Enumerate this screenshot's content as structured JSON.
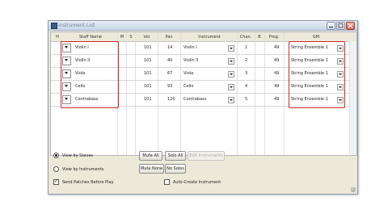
{
  "window": {
    "title": "Instrument List"
  },
  "columns": {
    "h": "H",
    "staff_name": "Staff Name",
    "m": "M",
    "s": "S",
    "vol": "Vol.",
    "pan": "Pan",
    "instrument": "Instrument",
    "chan": "Chan.",
    "b": "B",
    "prog": "Prog.",
    "gm": "GM"
  },
  "rows": [
    {
      "staff": "Violin I",
      "vol": "101",
      "pan": "14",
      "instrument": "Violin I",
      "chan": "1",
      "prog": "49",
      "gm": "String Ensemble 1"
    },
    {
      "staff": "Violin II",
      "vol": "101",
      "pan": "40",
      "instrument": "Violin II",
      "chan": "2",
      "prog": "49",
      "gm": "String Ensemble 1"
    },
    {
      "staff": "Viola",
      "vol": "101",
      "pan": "67",
      "instrument": "Viola",
      "chan": "3",
      "prog": "49",
      "gm": "String Ensemble 1"
    },
    {
      "staff": "Cello",
      "vol": "101",
      "pan": "93",
      "instrument": "Cello",
      "chan": "4",
      "prog": "49",
      "gm": "String Ensemble 1"
    },
    {
      "staff": "Contrabass",
      "vol": "101",
      "pan": "120",
      "instrument": "Contrabass",
      "chan": "5",
      "prog": "49",
      "gm": "String Ensemble 1"
    }
  ],
  "options": {
    "view_by_staves": "View by Staves",
    "view_by_instruments": "View by Instruments",
    "send_patches": "Send Patches Before Play",
    "auto_create": "Auto-Create Instrument"
  },
  "buttons": {
    "mute_all": "Mute All",
    "solo_all": "Solo All",
    "edit_instruments": "Edit Instruments",
    "mute_none": "Mute None",
    "no_solos": "No Solos"
  },
  "state": {
    "view_by_staves": true,
    "view_by_instruments": false,
    "send_patches": true,
    "auto_create": false
  },
  "colors": {
    "highlight": "#d22626",
    "window_bg": "#ece9d8"
  }
}
